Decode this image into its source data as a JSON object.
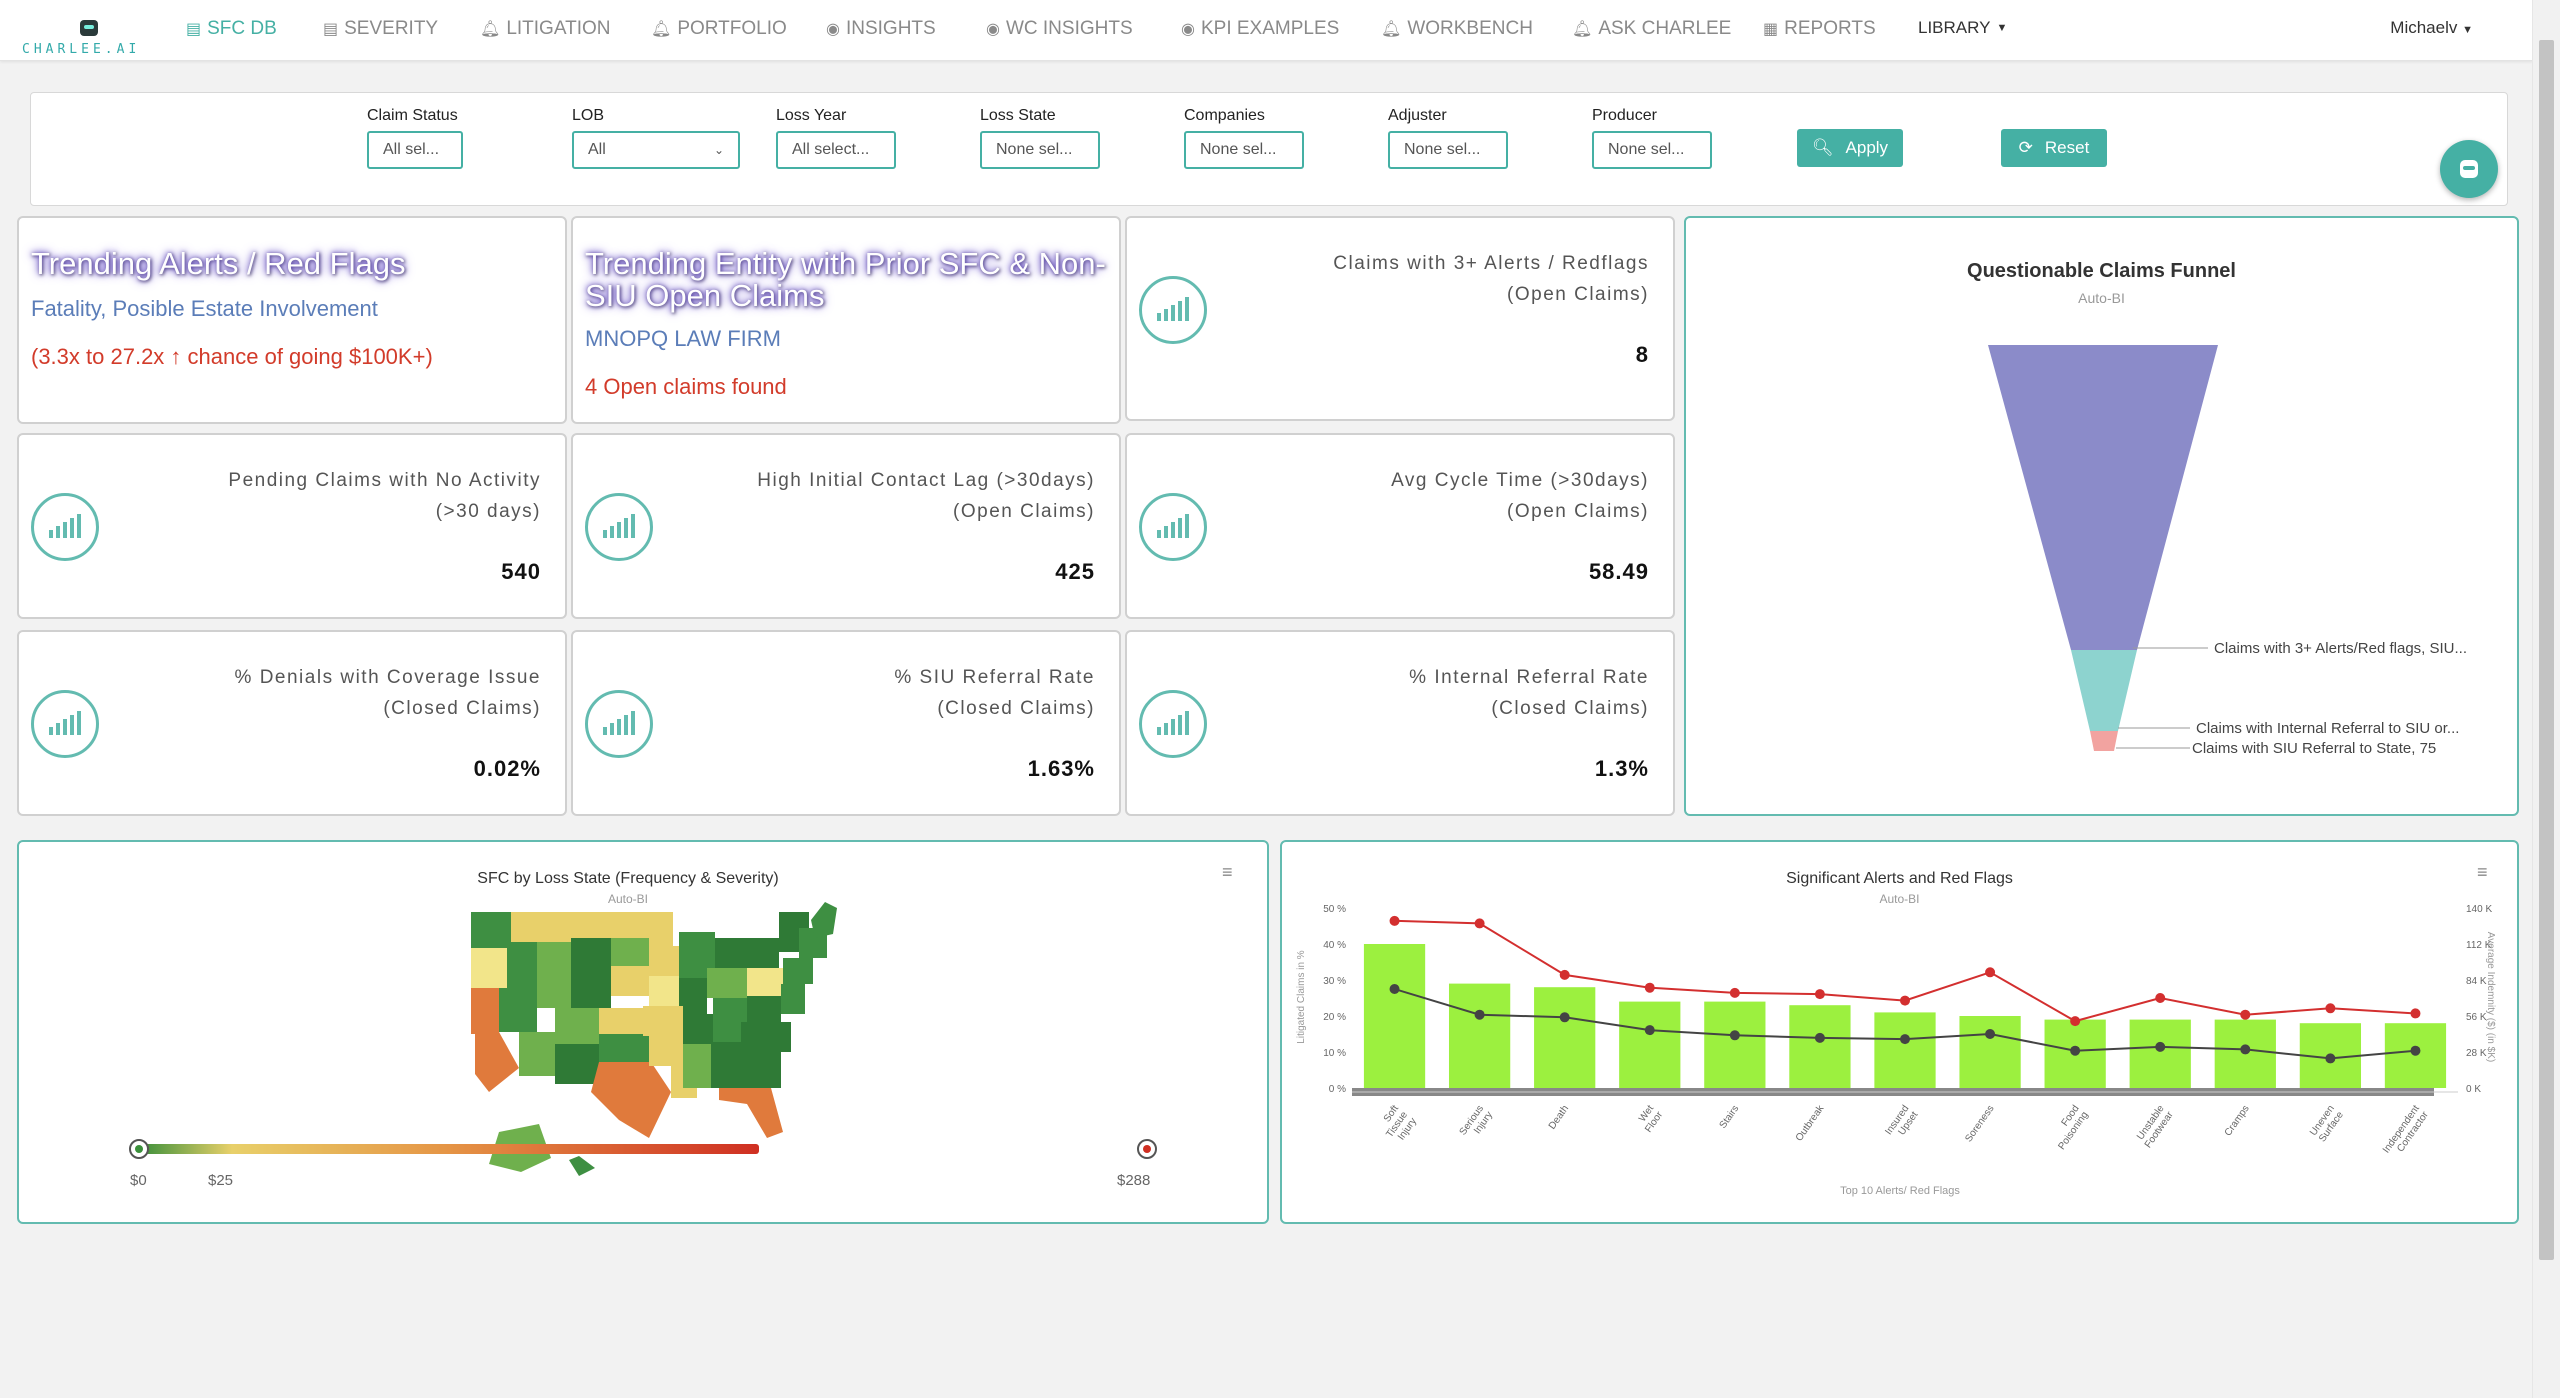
{
  "nav": {
    "logo_text": "CHARLEE.AI",
    "items": [
      {
        "label": "SFC DB",
        "icon": "chart-icon"
      },
      {
        "label": "SEVERITY",
        "icon": "chart-icon"
      },
      {
        "label": "LITIGATION",
        "icon": "bell-icon"
      },
      {
        "label": "PORTFOLIO",
        "icon": "bell-icon"
      },
      {
        "label": "INSIGHTS",
        "icon": "eye-icon"
      },
      {
        "label": "WC INSIGHTS",
        "icon": "eye-icon"
      },
      {
        "label": "KPI EXAMPLES",
        "icon": "eye-icon"
      },
      {
        "label": "WORKBENCH",
        "icon": "bell-icon"
      },
      {
        "label": "ASK CHARLEE",
        "icon": "bell-icon"
      },
      {
        "label": "REPORTS",
        "icon": "table-icon"
      },
      {
        "label": "LIBRARY",
        "icon": "caret-down-icon"
      }
    ],
    "user": "Michaelv"
  },
  "filters": [
    {
      "label": "Claim Status",
      "value": "All sel..."
    },
    {
      "label": "LOB",
      "value": "All"
    },
    {
      "label": "Loss Year",
      "value": "All select..."
    },
    {
      "label": "Loss State",
      "value": "None sel..."
    },
    {
      "label": "Companies",
      "value": "None sel..."
    },
    {
      "label": "Adjuster",
      "value": "None sel..."
    },
    {
      "label": "Producer",
      "value": "None sel..."
    }
  ],
  "buttons": {
    "apply": "Apply",
    "reset": "Reset"
  },
  "trend1": {
    "title": "Trending Alerts / Red Flags",
    "subtitle": "Fatality, Posible Estate Involvement",
    "note": "(3.3x to 27.2x ↑ chance of going $100K+)"
  },
  "trend2": {
    "title_line1": "Trending Entity with Prior SFC & Non-",
    "title_line2": "SIU Open Claims",
    "subtitle": "MNOPQ LAW FIRM",
    "note": "4 Open claims found"
  },
  "kpis": [
    {
      "line1": "Claims with 3+ Alerts / Redflags",
      "line2": "(Open Claims)",
      "value": "8"
    },
    {
      "line1": "Pending Claims with No Activity",
      "line2": "(>30 days)",
      "value": "540"
    },
    {
      "line1": "High Initial Contact Lag (>30days)",
      "line2": "(Open Claims)",
      "value": "425"
    },
    {
      "line1": "Avg Cycle Time (>30days)",
      "line2": "(Open Claims)",
      "value": "58.49"
    },
    {
      "line1": "% Denials with Coverage Issue",
      "line2": "(Closed Claims)",
      "value": "0.02%"
    },
    {
      "line1": "% SIU Referral Rate",
      "line2": "(Closed Claims)",
      "value": "1.63%"
    },
    {
      "line1": "% Internal Referral Rate",
      "line2": "(Closed Claims)",
      "value": "1.3%"
    }
  ],
  "funnel": {
    "title": "Questionable Claims Funnel",
    "subtitle": "Auto-BI",
    "labels": [
      "Claims with 3+ Alerts/Red flags, SIU...",
      "Claims with Internal Referral to SIU or...",
      "Claims with SIU Referral to State, 75"
    ],
    "colors": [
      "#8b8bc9",
      "#8dd3cf",
      "#f2a3a0"
    ]
  },
  "map": {
    "title": "SFC by Loss State (Frequency & Severity)",
    "subtitle": "Auto-BI",
    "scale_labels": [
      "$0",
      "$25",
      "$288"
    ]
  },
  "chart_data": {
    "type": "bar",
    "title": "Significant Alerts and Red Flags",
    "subtitle": "Auto-BI",
    "xlabel": "Top 10 Alerts/ Red Flags",
    "ylabel": "Litigated Claims in %",
    "y2label": "Average Indemnity ($) (in $K)",
    "ylim": [
      0,
      50
    ],
    "y2lim": [
      0,
      140
    ],
    "yticks": [
      "0 %",
      "10 %",
      "20 %",
      "30 %",
      "40 %",
      "50 %"
    ],
    "y2ticks": [
      "0 K",
      "28 K",
      "56 K",
      "84 K",
      "112 K",
      "140 K"
    ],
    "categories": [
      "Soft Tissue Injury",
      "Serious Injury",
      "Death",
      "Wet Floor",
      "Stairs",
      "Outbreak",
      "Insured Upset",
      "Soreness",
      "Food Poisoning",
      "Unstable Footwear",
      "Cramps",
      "Uneven Surface",
      "Independent Contractor"
    ],
    "series": [
      {
        "type": "bar",
        "color": "#9cf03f",
        "values": [
          40,
          29,
          28,
          24,
          24,
          23,
          21,
          20,
          19,
          19,
          19,
          18,
          18
        ]
      },
      {
        "type": "line",
        "color": "#d32f2f",
        "axis": "y2",
        "values": [
          130,
          128,
          88,
          78,
          74,
          73,
          68,
          90,
          52,
          70,
          57,
          62,
          58
        ]
      },
      {
        "type": "line",
        "color": "#444444",
        "axis": "y2",
        "values": [
          77,
          57,
          55,
          45,
          41,
          39,
          38,
          42,
          29,
          32,
          30,
          23,
          29
        ]
      }
    ]
  }
}
